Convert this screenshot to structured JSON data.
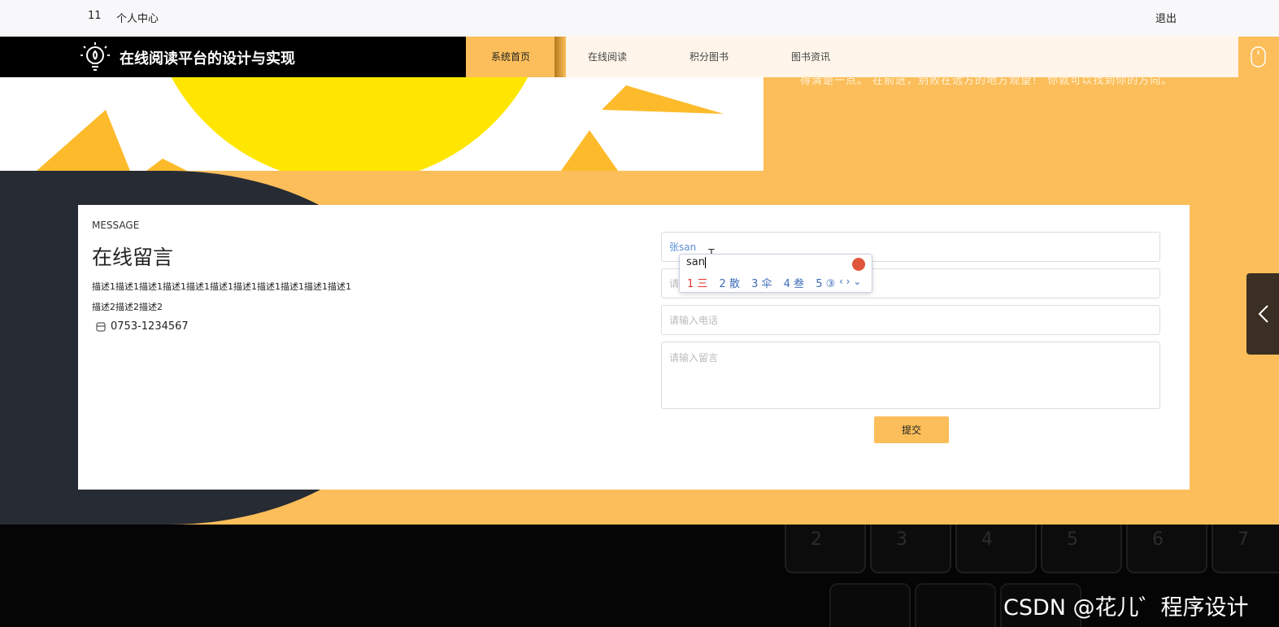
{
  "topbar": {
    "user_id": "11",
    "personal_center": "个人中心",
    "logout": "退出"
  },
  "header": {
    "site_title": "在线阅读平台的设计与实现",
    "nav": [
      "系统首页",
      "在线阅读",
      "积分图书",
      "图书资讯"
    ]
  },
  "banner": {
    "text": "得清楚一点。   在前进，别败在远方的地方观望！   你就可以找到你的方向。"
  },
  "message": {
    "eyebrow": "MESSAGE",
    "heading": "在线留言",
    "desc1": "描述1描述1描述1描述1描述1描述1描述1描述1描述1描述1描述1",
    "desc2": "描述2描述2描述2",
    "phone": "0753-1234567",
    "name_value": "张san",
    "field2_placeholder": "请输入",
    "phone_placeholder": "请输入电话",
    "content_placeholder": "请输入留言",
    "submit": "提交"
  },
  "ime": {
    "input": "san",
    "candidates": [
      "1 三",
      "2 散",
      "3 伞",
      "4 叁",
      "5 ③"
    ],
    "arrows": "‹ › ⌄"
  },
  "watermark": "CSDN @花儿゛程序设计",
  "keyboard": {
    "keys": [
      "2",
      "3",
      "4",
      "5",
      "6",
      "7"
    ]
  },
  "colors": {
    "accent": "#fcbe5a",
    "dark": "#272b33"
  }
}
